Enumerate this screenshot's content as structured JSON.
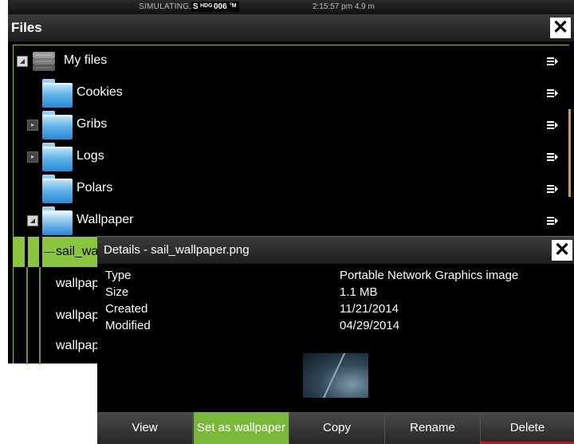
{
  "status": {
    "simulating": "SIMULATING...",
    "hdg_prefix": "S",
    "hdg_label": "HDG",
    "hdg_value": "006",
    "hdg_unit": "°M",
    "time": "2:15:57 pm  4.9 m"
  },
  "files": {
    "title": "Files",
    "close_glyph": "✕",
    "root": {
      "label": "My files",
      "expander": "◢",
      "icon": "database-icon"
    },
    "folders": [
      {
        "label": "Cookies",
        "expander": ""
      },
      {
        "label": "Gribs",
        "expander": "▸"
      },
      {
        "label": "Logs",
        "expander": "▸"
      },
      {
        "label": "Polars",
        "expander": ""
      },
      {
        "label": "Wallpaper",
        "expander": "◢"
      }
    ],
    "items": [
      {
        "label": "sail_wallpaper.png",
        "selected": true
      },
      {
        "label": "wallpaper"
      },
      {
        "label": "wallpaper"
      },
      {
        "label": "wallpaper"
      }
    ],
    "accent": "#8bc53f"
  },
  "details": {
    "title": "Details - sail_wallpaper.png",
    "close_glyph": "✕",
    "properties": [
      {
        "label": "Type",
        "value": "Portable Network Graphics image"
      },
      {
        "label": "Size",
        "value": "1.1 MB"
      },
      {
        "label": "Created",
        "value": "11/21/2014"
      },
      {
        "label": "Modified",
        "value": "04/29/2014"
      }
    ],
    "buttons": [
      {
        "label": "View"
      },
      {
        "label": "Set as wallpaper",
        "active": true
      },
      {
        "label": "Copy"
      },
      {
        "label": "Rename"
      },
      {
        "label": "Delete"
      }
    ]
  }
}
